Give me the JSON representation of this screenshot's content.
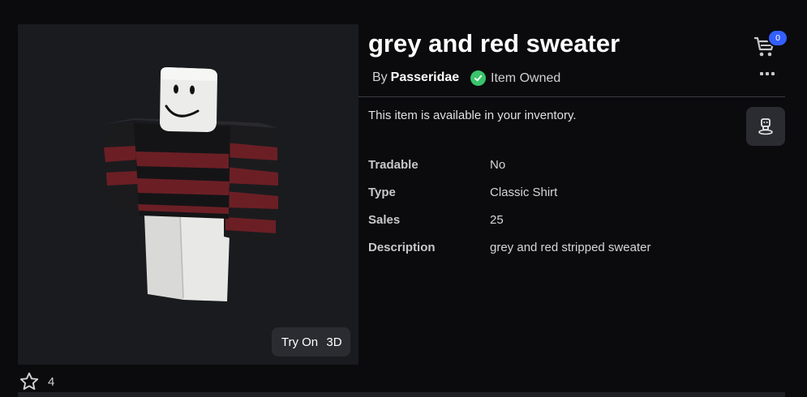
{
  "item": {
    "title": "grey and red sweater",
    "by_label": "By",
    "creator": "Passeridae",
    "owned_label": "Item Owned",
    "availability": "This item is available in your inventory."
  },
  "preview": {
    "try_on_label": "Try On",
    "three_d_label": "3D"
  },
  "header": {
    "cart_count": "0"
  },
  "details": [
    {
      "key": "Tradable",
      "value": "No"
    },
    {
      "key": "Type",
      "value": "Classic Shirt"
    },
    {
      "key": "Sales",
      "value": "25"
    },
    {
      "key": "Description",
      "value": "grey and red stripped sweater"
    }
  ],
  "favorites": {
    "count": "4"
  },
  "colors": {
    "background": "#0b0b0d",
    "panel": "#191b1f",
    "button": "#2a2c31",
    "accent_blue": "#335fff",
    "owned_green": "#3ac46a",
    "sweater_red": "#6b1f25",
    "sweater_black": "#1a1a1c"
  },
  "icons": {
    "cart": "shopping-cart-icon",
    "more": "more-options-icon",
    "owned": "check-circle-icon",
    "avatar_try": "avatar-icon",
    "favorite": "star-icon"
  }
}
